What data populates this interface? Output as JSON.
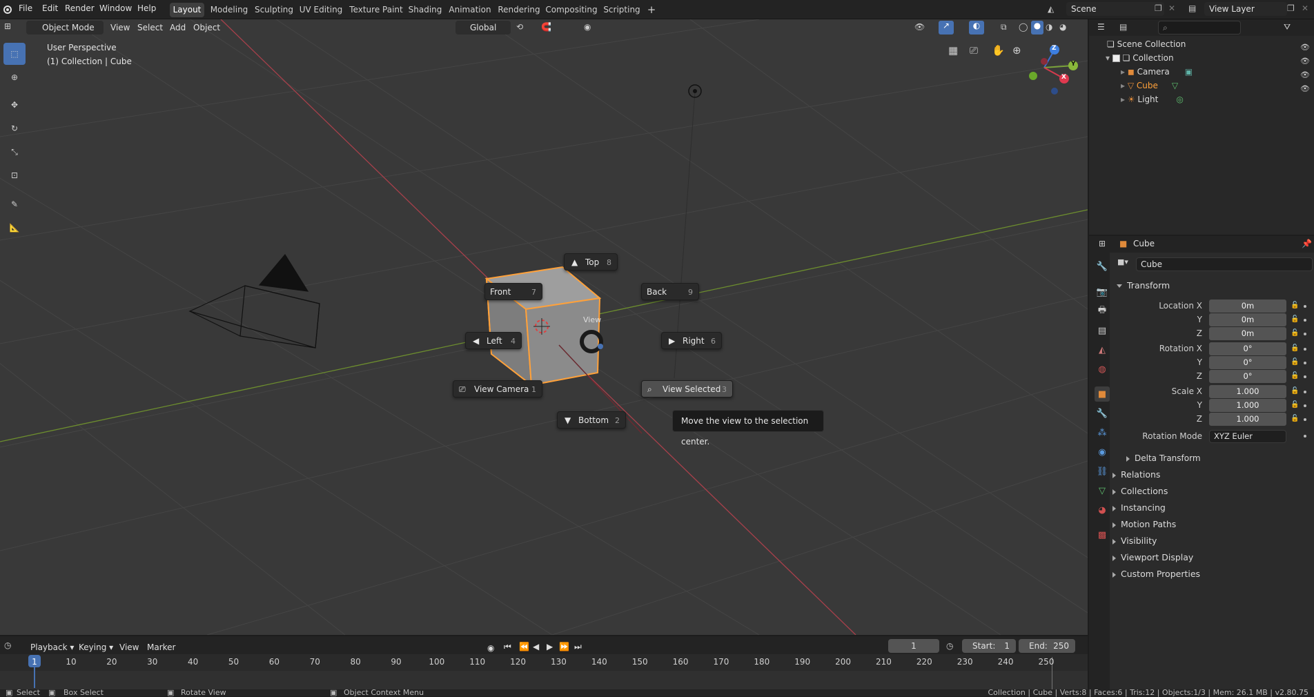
{
  "topbar": {
    "menus": [
      "File",
      "Edit",
      "Render",
      "Window",
      "Help"
    ],
    "workspaces": [
      "Layout",
      "Modeling",
      "Sculpting",
      "UV Editing",
      "Texture Paint",
      "Shading",
      "Animation",
      "Rendering",
      "Compositing",
      "Scripting",
      "+"
    ],
    "active_workspace": "Layout",
    "scene": "Scene",
    "view_layer": "View Layer"
  },
  "viewport": {
    "mode": "Object Mode",
    "menus": [
      "View",
      "Select",
      "Add",
      "Object"
    ],
    "orientation": "Global",
    "overlay_line1": "User Perspective",
    "overlay_line2": "(1) Collection | Cube",
    "cube_view_partial": "View",
    "gizmo": {
      "z": "Z",
      "y": "Y",
      "x": "X"
    }
  },
  "pie_menu": {
    "top": {
      "label": "Top",
      "key": "8"
    },
    "front": {
      "label": "Front",
      "key": "7"
    },
    "back": {
      "label": "Back",
      "key": "9"
    },
    "left": {
      "label": "Left",
      "key": "4"
    },
    "right": {
      "label": "Right",
      "key": "6"
    },
    "view_camera": {
      "label": "View Camera",
      "key": "1"
    },
    "view_selected": {
      "label": "View Selected",
      "key": "3"
    },
    "bottom": {
      "label": "Bottom",
      "key": "2"
    }
  },
  "tooltip": "Move the view to the selection center.",
  "outliner": {
    "root": "Scene Collection",
    "collection": "Collection",
    "items": [
      "Camera",
      "Cube",
      "Light"
    ]
  },
  "properties": {
    "object_header": "Cube",
    "object_name": "Cube",
    "transform_title": "Transform",
    "location_label": "Location X",
    "rotation_label": "Rotation X",
    "scale_label": "Scale X",
    "axis_y": "Y",
    "axis_z": "Z",
    "location": [
      "0m",
      "0m",
      "0m"
    ],
    "rotation": [
      "0°",
      "0°",
      "0°"
    ],
    "scale": [
      "1.000",
      "1.000",
      "1.000"
    ],
    "rotation_mode_label": "Rotation Mode",
    "rotation_mode": "XYZ Euler",
    "delta_transform": "Delta Transform",
    "sections": [
      "Relations",
      "Collections",
      "Instancing",
      "Motion Paths",
      "Visibility",
      "Viewport Display",
      "Custom Properties"
    ]
  },
  "timeline": {
    "menus": [
      "Playback",
      "Keying",
      "View",
      "Marker"
    ],
    "current_frame": "1",
    "start_label": "Start:",
    "start": "1",
    "end_label": "End:",
    "end": "250",
    "ticks": [
      "1",
      "10",
      "20",
      "30",
      "40",
      "50",
      "60",
      "70",
      "80",
      "90",
      "100",
      "110",
      "120",
      "130",
      "140",
      "150",
      "160",
      "170",
      "180",
      "190",
      "200",
      "210",
      "220",
      "230",
      "240",
      "250"
    ]
  },
  "statusbar": {
    "select": "Select",
    "box_select": "Box Select",
    "rotate_view": "Rotate View",
    "context_menu": "Object Context Menu",
    "stats": "Collection | Cube | Verts:8 | Faces:6 | Tris:12 | Objects:1/3 | Mem: 26.1 MB | v2.80.75"
  },
  "colors": {
    "accent": "#4772b3",
    "selected_orange": "#ffa13a",
    "x_axis": "#b3404d",
    "y_axis": "#7aa33a"
  }
}
